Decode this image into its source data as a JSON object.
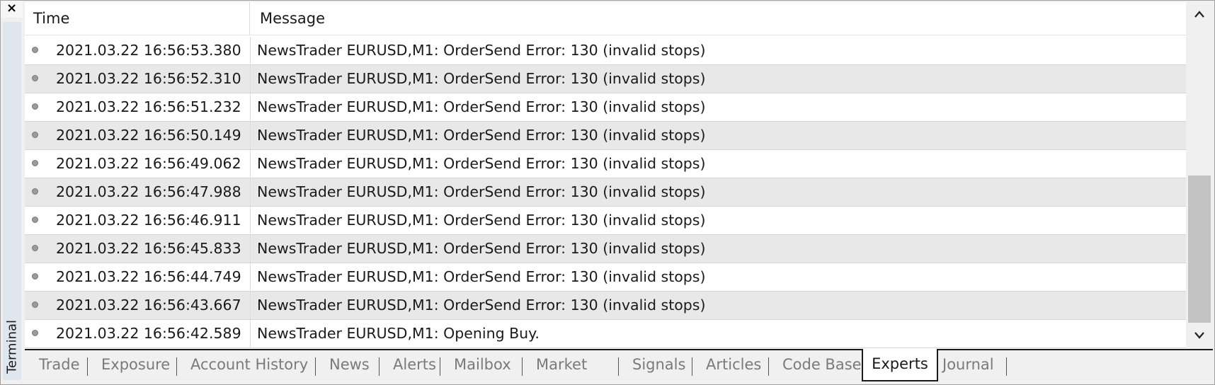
{
  "window": {
    "close_symbol": "×",
    "side_label": "Terminal"
  },
  "table": {
    "columns": [
      "Time",
      "Message"
    ],
    "rows": [
      {
        "time": "2021.03.22 16:56:53.380",
        "message": "NewsTrader EURUSD,M1: OrderSend Error: 130 (invalid stops)"
      },
      {
        "time": "2021.03.22 16:56:52.310",
        "message": "NewsTrader EURUSD,M1: OrderSend Error: 130 (invalid stops)"
      },
      {
        "time": "2021.03.22 16:56:51.232",
        "message": "NewsTrader EURUSD,M1: OrderSend Error: 130 (invalid stops)"
      },
      {
        "time": "2021.03.22 16:56:50.149",
        "message": "NewsTrader EURUSD,M1: OrderSend Error: 130 (invalid stops)"
      },
      {
        "time": "2021.03.22 16:56:49.062",
        "message": "NewsTrader EURUSD,M1: OrderSend Error: 130 (invalid stops)"
      },
      {
        "time": "2021.03.22 16:56:47.988",
        "message": "NewsTrader EURUSD,M1: OrderSend Error: 130 (invalid stops)"
      },
      {
        "time": "2021.03.22 16:56:46.911",
        "message": "NewsTrader EURUSD,M1: OrderSend Error: 130 (invalid stops)"
      },
      {
        "time": "2021.03.22 16:56:45.833",
        "message": "NewsTrader EURUSD,M1: OrderSend Error: 130 (invalid stops)"
      },
      {
        "time": "2021.03.22 16:56:44.749",
        "message": "NewsTrader EURUSD,M1: OrderSend Error: 130 (invalid stops)"
      },
      {
        "time": "2021.03.22 16:56:43.667",
        "message": "NewsTrader EURUSD,M1: OrderSend Error: 130 (invalid stops)"
      },
      {
        "time": "2021.03.22 16:56:42.589",
        "message": "NewsTrader EURUSD,M1: Opening Buy."
      }
    ]
  },
  "tabs": [
    {
      "label": "Trade"
    },
    {
      "label": "Exposure"
    },
    {
      "label": "Account History"
    },
    {
      "label": "News"
    },
    {
      "label": "Alerts"
    },
    {
      "label": "Mailbox"
    },
    {
      "label": "Market"
    },
    {
      "label": "Signals"
    },
    {
      "label": "Articles"
    },
    {
      "label": "Code Base"
    },
    {
      "label": "Experts"
    },
    {
      "label": "Journal"
    }
  ],
  "active_tab": "Experts",
  "colors": {
    "row_alt": "#e8e8e8",
    "inactive_tab_text": "#7a7a7a",
    "log_dot": "#9a9a9a",
    "side_bar": "#dfe6ee"
  },
  "icons": {
    "close": "close-icon",
    "scroll_up": "chevron-up-icon",
    "scroll_down": "chevron-down-icon",
    "row_status": "gray-dot-icon"
  }
}
